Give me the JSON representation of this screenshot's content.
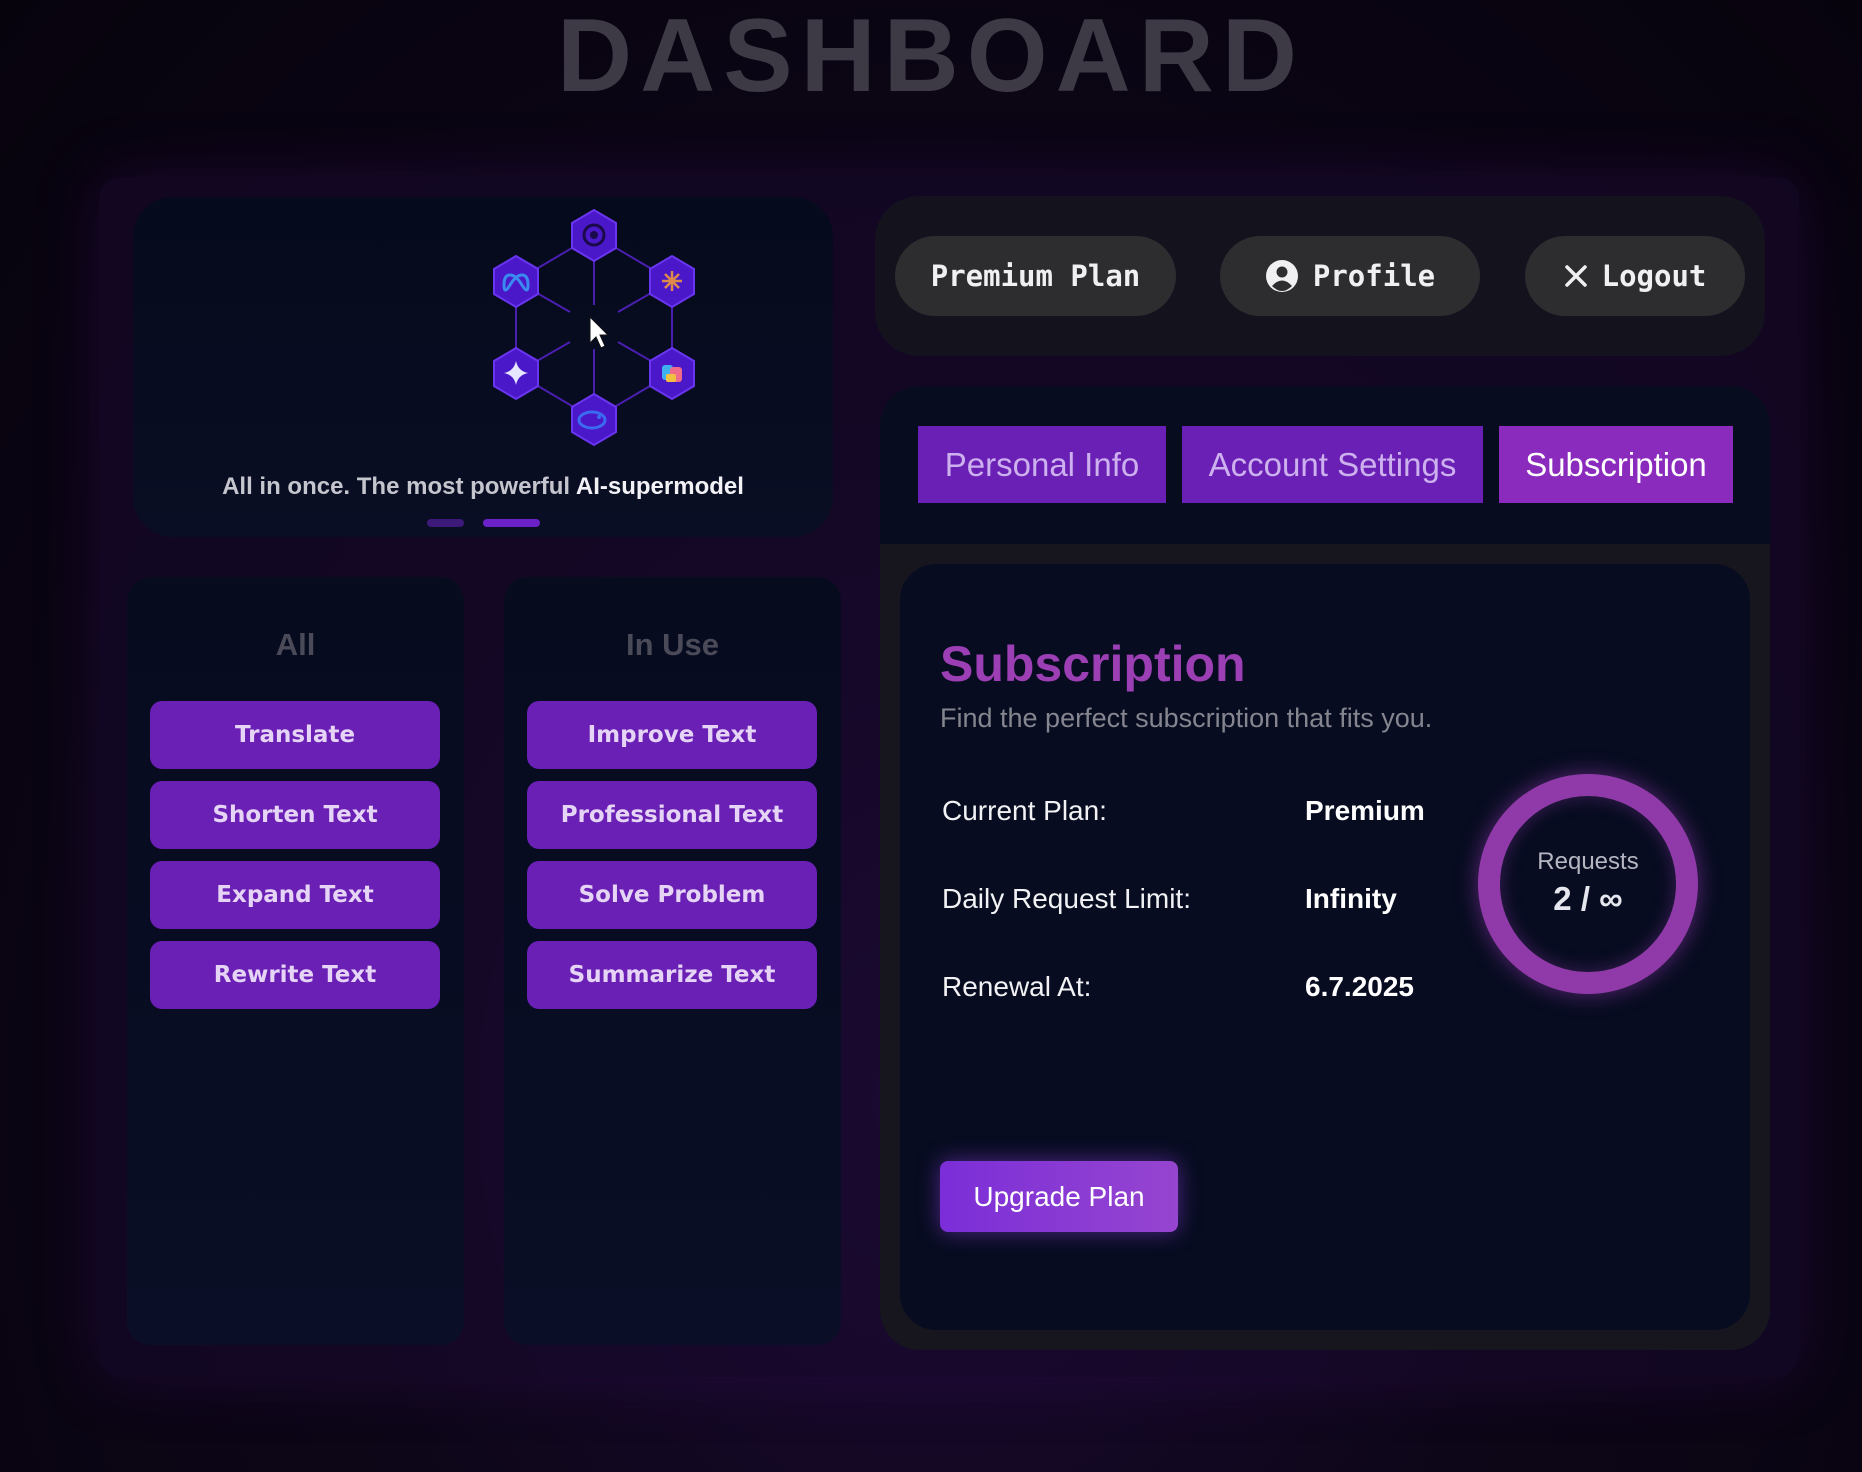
{
  "page": {
    "title": "DASHBOARD"
  },
  "hero": {
    "tagline_prefix": "All in once. The most powerful ",
    "tagline_highlight": "AI-supermodel",
    "model_icons": [
      "openai-icon",
      "claude-icon",
      "copilot-icon",
      "deepseek-icon",
      "gemini-icon",
      "meta-icon"
    ],
    "carousel": {
      "count": 2,
      "active": 2
    }
  },
  "tools": {
    "all": {
      "title": "All",
      "items": [
        "Translate",
        "Shorten Text",
        "Expand Text",
        "Rewrite Text"
      ]
    },
    "in_use": {
      "title": "In Use",
      "items": [
        "Improve Text",
        "Professional Text",
        "Solve Problem",
        "Summarize Text"
      ]
    }
  },
  "topbar": {
    "plan_label": "Premium Plan",
    "profile_label": "Profile",
    "logout_label": "Logout"
  },
  "tabs": [
    {
      "label": "Personal Info",
      "active": false
    },
    {
      "label": "Account Settings",
      "active": false
    },
    {
      "label": "Subscription",
      "active": true
    }
  ],
  "subscription": {
    "title": "Subscription",
    "description": "Find the perfect subscription that fits you.",
    "rows": [
      {
        "label": "Current Plan:",
        "value": "Premium"
      },
      {
        "label": "Daily Request Limit:",
        "value": "Infinity"
      },
      {
        "label": "Renewal At:",
        "value": "6.7.2025"
      }
    ],
    "requests_label": "Requests",
    "requests_value": "2 / ∞",
    "upgrade_label": "Upgrade Plan"
  },
  "colors": {
    "accent": "#6a1fb5",
    "active_tab": "#8a2bbd",
    "ring": "#8f3aa8",
    "subscription_title": "#9c3fb4"
  }
}
